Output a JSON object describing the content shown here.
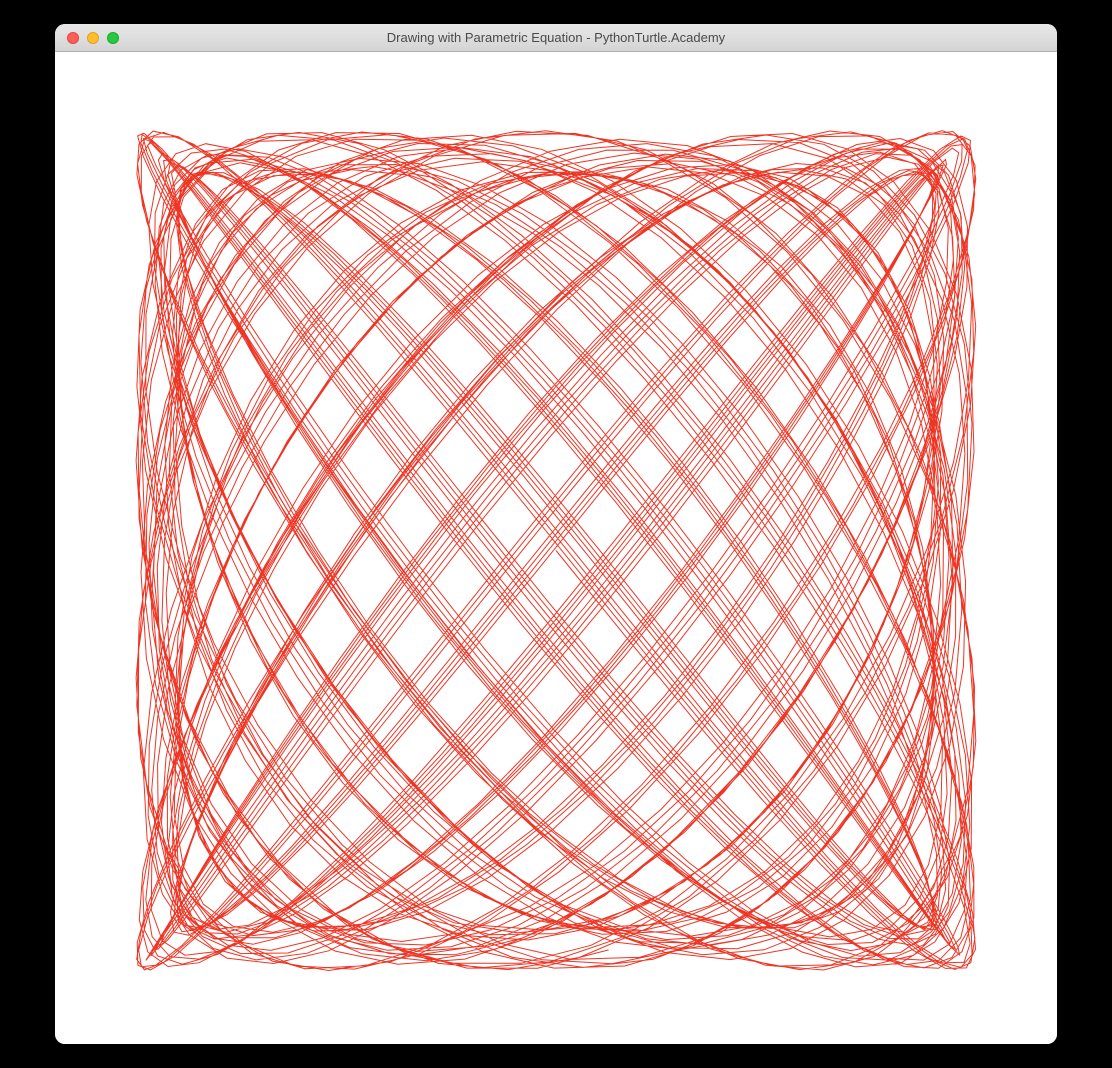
{
  "window": {
    "title": "Drawing with Parametric Equation - PythonTurtle.Academy"
  },
  "drawing": {
    "stroke_color": "#ee3524",
    "stroke_width": 1,
    "parametric": {
      "a": 4,
      "b": 5,
      "scale": 420,
      "steps": 3000,
      "t_max_multiplier": 40
    }
  }
}
